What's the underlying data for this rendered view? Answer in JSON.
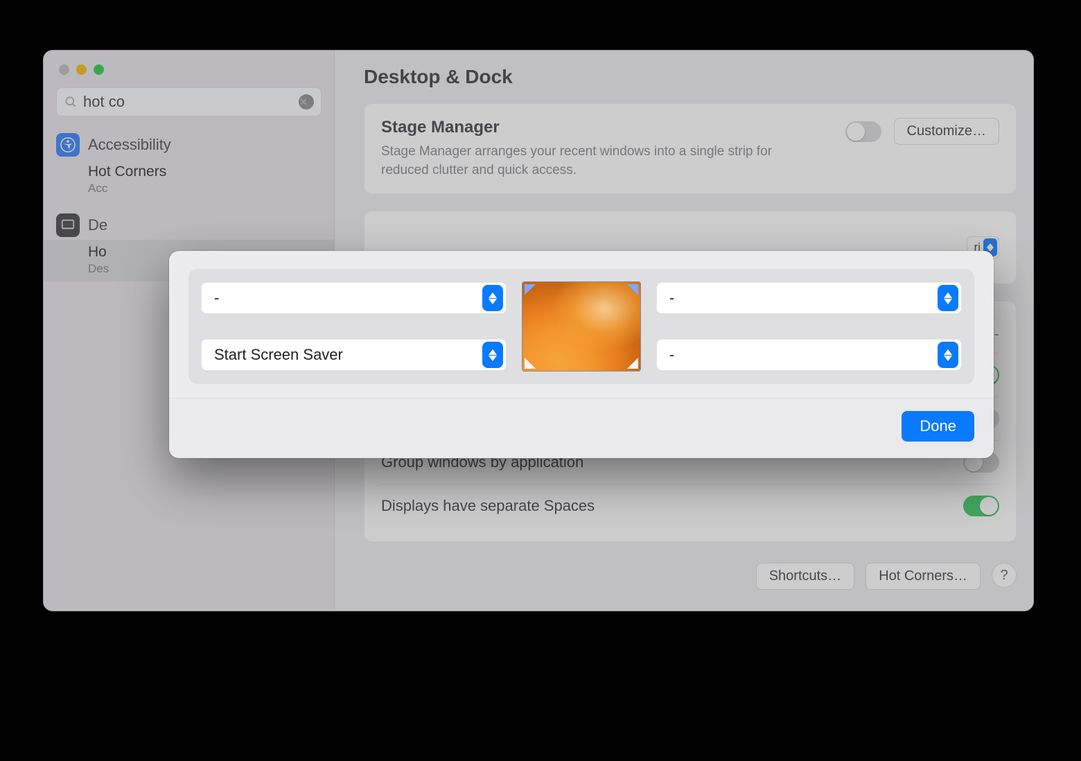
{
  "window": {
    "title": "Desktop & Dock"
  },
  "search": {
    "value": "hot co"
  },
  "sidebar": {
    "groups": [
      {
        "icon": "accessibility",
        "label": "Accessibility",
        "items": [
          {
            "title": "Hot Corners",
            "sub": "Acc"
          }
        ]
      },
      {
        "icon": "dock",
        "label": "De",
        "items": [
          {
            "title": "Ho",
            "sub": "Des"
          }
        ]
      }
    ]
  },
  "stage": {
    "title": "Stage Manager",
    "desc": "Stage Manager arranges your recent windows into a single strip for reduced clutter and quick access.",
    "customize": "Customize…"
  },
  "main_rows": {
    "default_browser_tail": "ri",
    "group_windows": "Group windows by application",
    "separate_spaces": "Displays have separate Spaces"
  },
  "footer": {
    "shortcuts": "Shortcuts…",
    "hotcorners": "Hot Corners…"
  },
  "hotcorners_modal": {
    "top_left": "-",
    "top_right": "-",
    "bottom_left": "Start Screen Saver",
    "bottom_right": "-",
    "done": "Done"
  }
}
